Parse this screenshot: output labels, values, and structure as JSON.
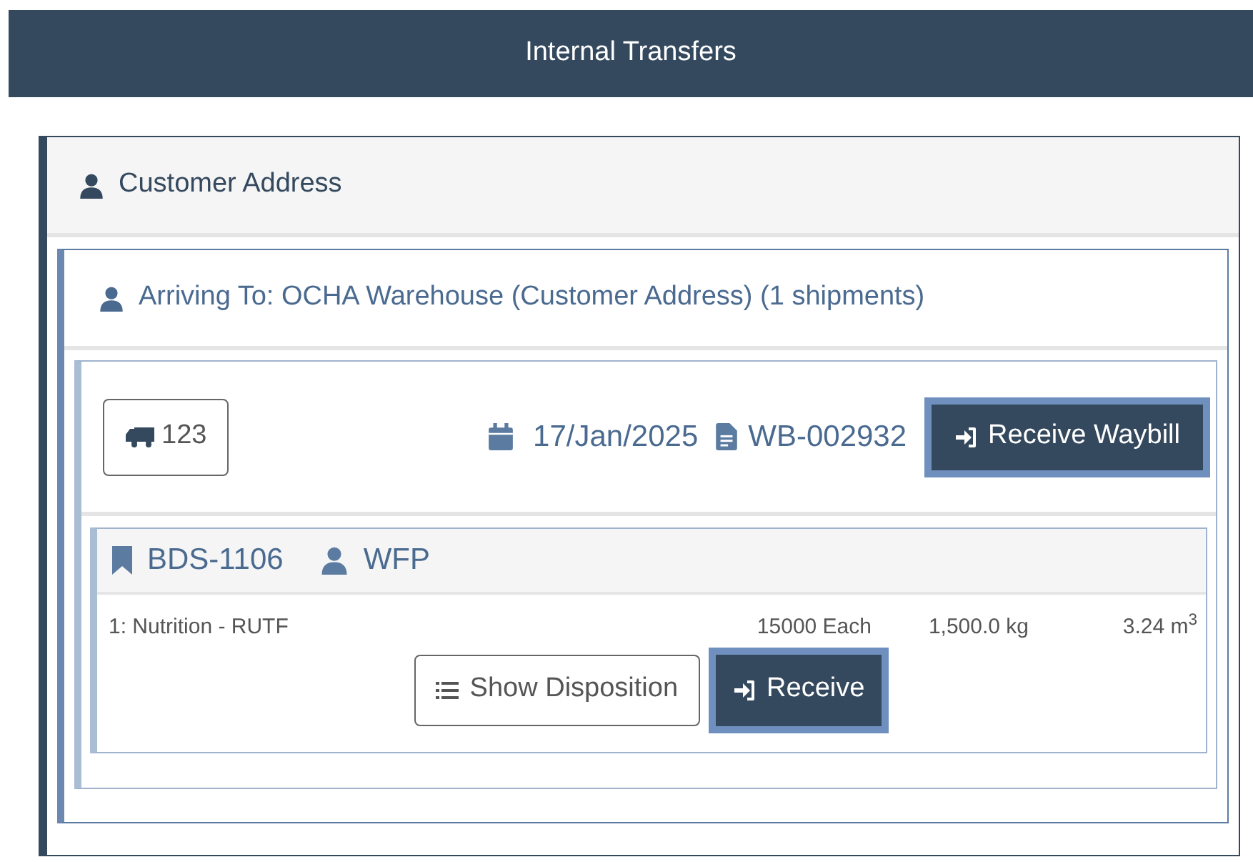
{
  "header": {
    "title": "Internal Transfers"
  },
  "customer_section": {
    "title": "Customer Address"
  },
  "arrival_section": {
    "title": "Arriving To: OCHA Warehouse (Customer Address) (1 shipments)"
  },
  "shipment": {
    "vehicle": "123",
    "date": "17/Jan/2025",
    "waybill": "WB-002932",
    "receive_button": "Receive Waybill",
    "consignment": {
      "reference": "BDS-1106",
      "owner": "WFP",
      "items": [
        {
          "description": "1: Nutrition - RUTF",
          "quantity": "15000 Each",
          "weight": "1,500.0 kg",
          "volume": "3.24 m$^{3}$"
        }
      ],
      "buttons": [
        {
          "kind": "outline",
          "label": "Show Disposition"
        },
        {
          "kind": "primary",
          "label": "Receive"
        }
      ]
    }
  }
}
